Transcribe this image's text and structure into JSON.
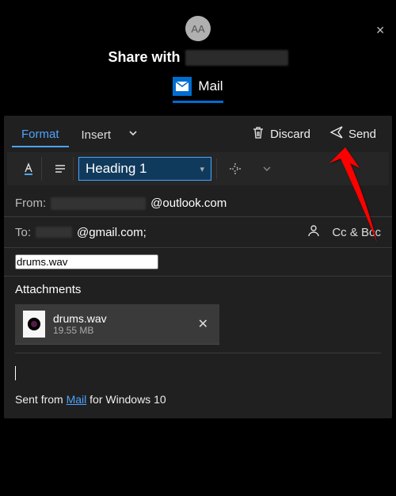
{
  "header": {
    "avatar_initials": "AA",
    "share_label": "Share with",
    "app_tab_label": "Mail"
  },
  "toolbar": {
    "tabs": {
      "format": "Format",
      "insert": "Insert"
    },
    "discard_label": "Discard",
    "send_label": "Send",
    "style_dropdown": "Heading 1"
  },
  "fields": {
    "from_label": "From:",
    "from_domain": "@outlook.com",
    "to_label": "To:",
    "to_domain": "@gmail.com;",
    "ccbcc_label": "Cc & Bcc",
    "subject_value": "drums.wav",
    "attachments_heading": "Attachments"
  },
  "attachment": {
    "name": "drums.wav",
    "size": "19.55 MB"
  },
  "signature": {
    "prefix": "Sent from ",
    "link": "Mail",
    "suffix": " for Windows 10"
  }
}
